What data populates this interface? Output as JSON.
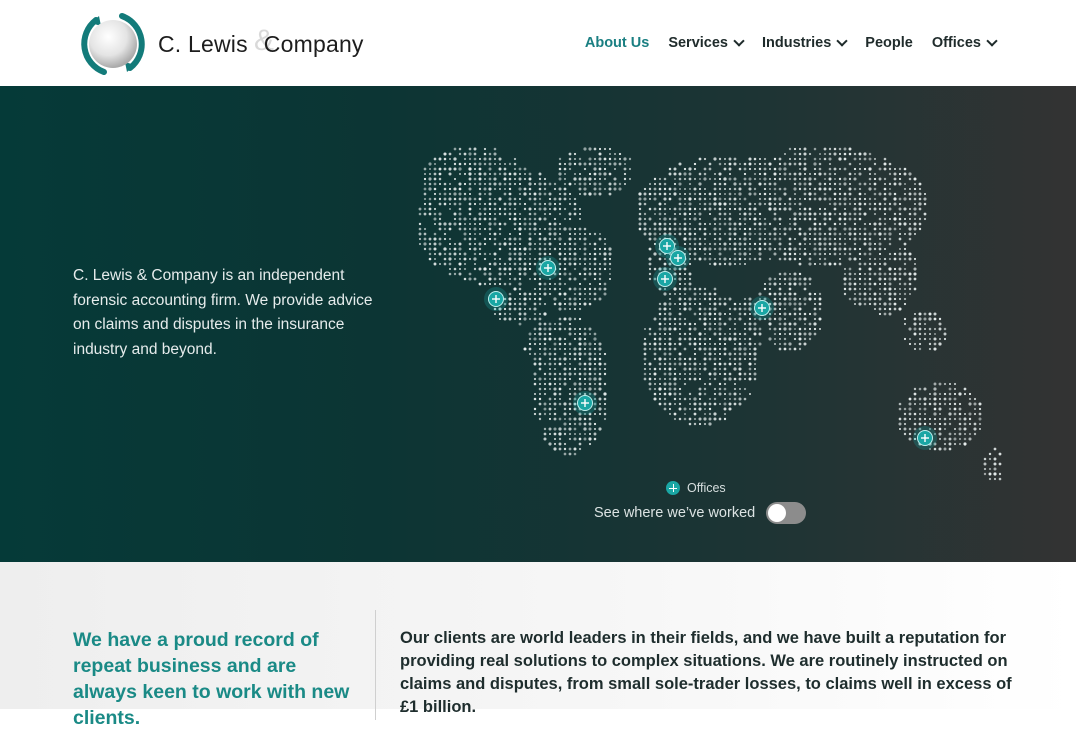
{
  "brand": {
    "name_part1": "C. Lewis",
    "amp": "&",
    "name_part2": "Company"
  },
  "nav": {
    "items": [
      {
        "label": "About Us",
        "active": true,
        "has_dropdown": false
      },
      {
        "label": "Services",
        "active": false,
        "has_dropdown": true
      },
      {
        "label": "Industries",
        "active": false,
        "has_dropdown": true
      },
      {
        "label": "People",
        "active": false,
        "has_dropdown": false
      },
      {
        "label": "Offices",
        "active": false,
        "has_dropdown": true
      }
    ]
  },
  "hero": {
    "intro": "C. Lewis & Company is an independent forensic accounting firm. We provide advice on claims and disputes in the insurance industry and beyond.",
    "legend_label": "Offices",
    "toggle_label": "See where we’ve worked",
    "toggle_on": false
  },
  "about": {
    "tagline": "We have a proud record of repeat business and are always keen to work with new clients.",
    "body": "Our clients are world leaders in their fields, and we have built a reputation for providing real solutions to complex situations.  We are routinely instructed on claims and disputes, from small sole-trader losses, to claims well in excess of £1 billion."
  },
  "colors": {
    "accent": "#1a7f82",
    "tagline": "#1a8a86",
    "marker": "#1aa6a4",
    "hero_dark": "#053a38",
    "hero_gray": "#333333"
  }
}
